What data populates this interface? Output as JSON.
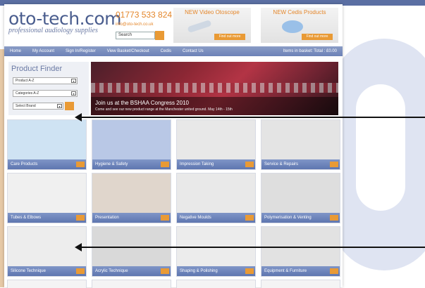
{
  "logo": {
    "name": "oto-tech.com",
    "tagline": "professional audiology supplies"
  },
  "contact": {
    "phone": "01773 533 824",
    "email": "info@oto-tech.co.uk"
  },
  "search": {
    "value": "Search"
  },
  "promos": [
    {
      "title": "NEW Video Otoscope",
      "button": "Find out more"
    },
    {
      "title": "NEW Cedis Products",
      "button": "Find out more"
    }
  ],
  "nav": {
    "items": [
      "Home",
      "My Account",
      "Sign In/Register",
      "View Basket/Checkout",
      "Cedis",
      "Contact Us"
    ],
    "basket": "Items in basket: Total : £0.00"
  },
  "finder": {
    "title": "Product Finder",
    "selects": [
      "Product A-Z",
      "Categories A-Z",
      "Select Brand"
    ]
  },
  "banner": {
    "headline": "Join us at the BSHAA Congress 2010",
    "sub": "Come and see our new product range at the Manchester united ground. May 14th - 15th"
  },
  "tiles": [
    {
      "label": "Care Products",
      "color": "#cfe3f3"
    },
    {
      "label": "Hygiene & Safety",
      "color": "#b9c8e6"
    },
    {
      "label": "Impression Taking",
      "color": "#e8e8e8"
    },
    {
      "label": "Service & Repairs",
      "color": "#e4e4e4"
    },
    {
      "label": "Tubes & Elbows",
      "color": "#f0f0f0"
    },
    {
      "label": "Presentation",
      "color": "#e0d6cc"
    },
    {
      "label": "Negative Moulds",
      "color": "#e9e9e9"
    },
    {
      "label": "Polymerisation & Venting",
      "color": "#dedede"
    },
    {
      "label": "Silicone Technique",
      "color": "#ededed"
    },
    {
      "label": "Acrylic Technique",
      "color": "#d9d9d9"
    },
    {
      "label": "Shaping & Polishing",
      "color": "#ececec"
    },
    {
      "label": "Equipment & Furniture",
      "color": "#e2e2e2"
    }
  ]
}
